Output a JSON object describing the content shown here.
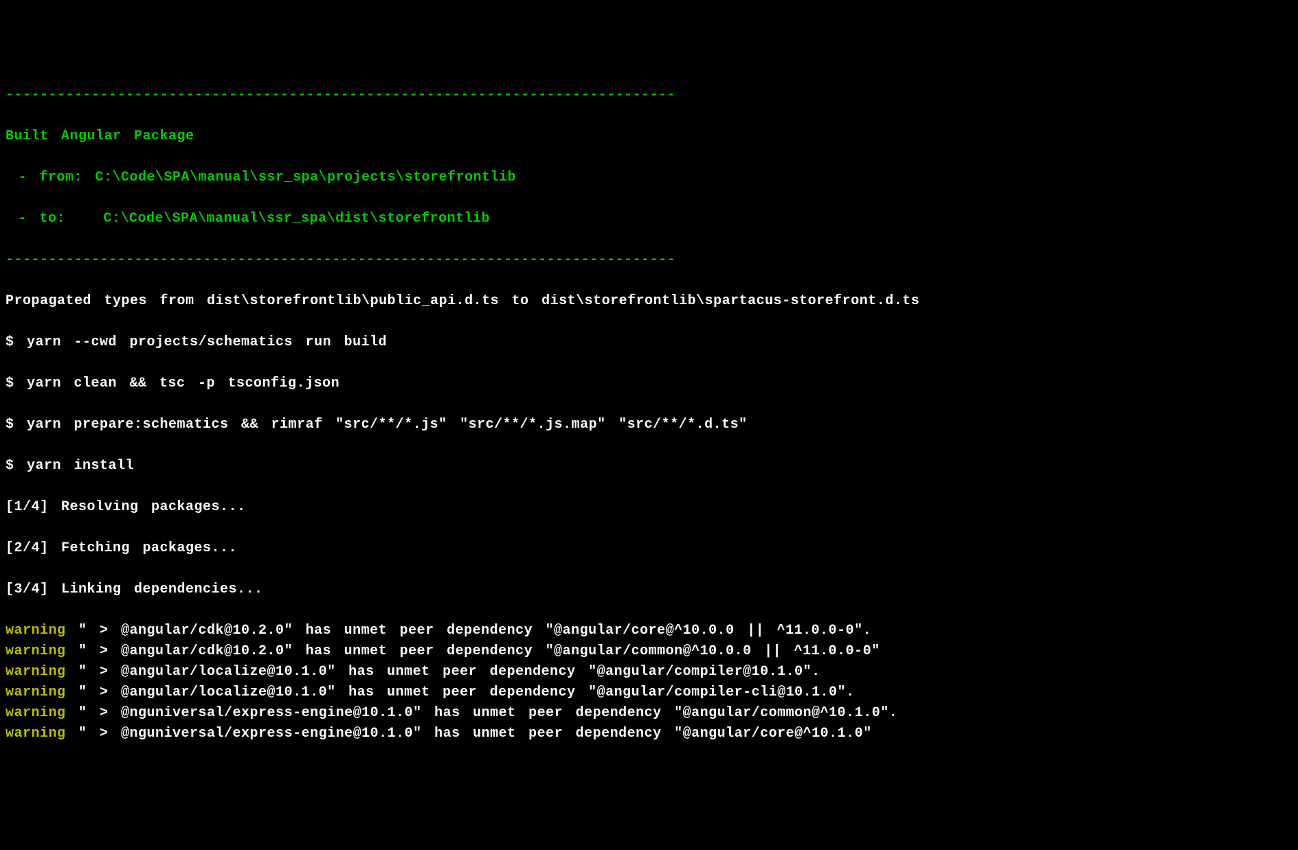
{
  "separator_top": "------------------------------------------------------------------------------",
  "header": {
    "built_line": "Built Angular Package",
    "from_line": " - from: C:\\Code\\SPA\\manual\\ssr_spa\\projects\\storefrontlib",
    "to_line": " - to:   C:\\Code\\SPA\\manual\\ssr_spa\\dist\\storefrontlib"
  },
  "separator_bottom": "------------------------------------------------------------------------------",
  "body": {
    "propagated": "Propagated types from dist\\storefrontlib\\public_api.d.ts to dist\\storefrontlib\\spartacus-storefront.d.ts",
    "cmd1": "$ yarn --cwd projects/schematics run build",
    "cmd2": "$ yarn clean && tsc -p tsconfig.json",
    "cmd3": "$ yarn prepare:schematics && rimraf \"src/**/*.js\" \"src/**/*.js.map\" \"src/**/*.d.ts\"",
    "cmd4": "$ yarn install",
    "step1": "[1/4] Resolving packages...",
    "step2": "[2/4] Fetching packages...",
    "step3": "[3/4] Linking dependencies..."
  },
  "warnings": [
    {
      "prefix": "warning",
      "text": " \" > @angular/cdk@10.2.0\" has unmet peer dependency \"@angular/core@^10.0.0 || ^11.0.0-0\"."
    },
    {
      "prefix": "warning",
      "text": " \" > @angular/cdk@10.2.0\" has unmet peer dependency \"@angular/common@^10.0.0 || ^11.0.0-0\""
    },
    {
      "prefix": "warning",
      "text": " \" > @angular/localize@10.1.0\" has unmet peer dependency \"@angular/compiler@10.1.0\"."
    },
    {
      "prefix": "warning",
      "text": " \" > @angular/localize@10.1.0\" has unmet peer dependency \"@angular/compiler-cli@10.1.0\"."
    },
    {
      "prefix": "warning",
      "text": " \" > @nguniversal/express-engine@10.1.0\" has unmet peer dependency \"@angular/common@^10.1.0\"."
    },
    {
      "prefix": "warning",
      "text": " \" > @nguniversal/express-engine@10.1.0\" has unmet peer dependency \"@angular/core@^10.1.0\""
    }
  ]
}
